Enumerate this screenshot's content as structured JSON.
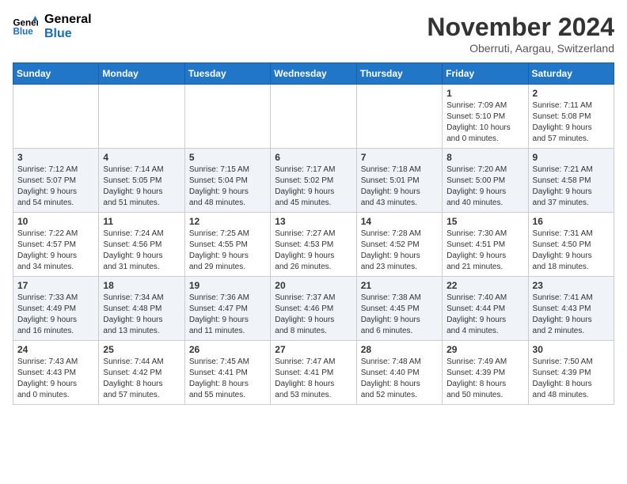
{
  "header": {
    "logo_line1": "General",
    "logo_line2": "Blue",
    "month_title": "November 2024",
    "location": "Oberruti, Aargau, Switzerland"
  },
  "weekdays": [
    "Sunday",
    "Monday",
    "Tuesday",
    "Wednesday",
    "Thursday",
    "Friday",
    "Saturday"
  ],
  "weeks": [
    [
      {
        "day": "",
        "info": ""
      },
      {
        "day": "",
        "info": ""
      },
      {
        "day": "",
        "info": ""
      },
      {
        "day": "",
        "info": ""
      },
      {
        "day": "",
        "info": ""
      },
      {
        "day": "1",
        "info": "Sunrise: 7:09 AM\nSunset: 5:10 PM\nDaylight: 10 hours\nand 0 minutes."
      },
      {
        "day": "2",
        "info": "Sunrise: 7:11 AM\nSunset: 5:08 PM\nDaylight: 9 hours\nand 57 minutes."
      }
    ],
    [
      {
        "day": "3",
        "info": "Sunrise: 7:12 AM\nSunset: 5:07 PM\nDaylight: 9 hours\nand 54 minutes."
      },
      {
        "day": "4",
        "info": "Sunrise: 7:14 AM\nSunset: 5:05 PM\nDaylight: 9 hours\nand 51 minutes."
      },
      {
        "day": "5",
        "info": "Sunrise: 7:15 AM\nSunset: 5:04 PM\nDaylight: 9 hours\nand 48 minutes."
      },
      {
        "day": "6",
        "info": "Sunrise: 7:17 AM\nSunset: 5:02 PM\nDaylight: 9 hours\nand 45 minutes."
      },
      {
        "day": "7",
        "info": "Sunrise: 7:18 AM\nSunset: 5:01 PM\nDaylight: 9 hours\nand 43 minutes."
      },
      {
        "day": "8",
        "info": "Sunrise: 7:20 AM\nSunset: 5:00 PM\nDaylight: 9 hours\nand 40 minutes."
      },
      {
        "day": "9",
        "info": "Sunrise: 7:21 AM\nSunset: 4:58 PM\nDaylight: 9 hours\nand 37 minutes."
      }
    ],
    [
      {
        "day": "10",
        "info": "Sunrise: 7:22 AM\nSunset: 4:57 PM\nDaylight: 9 hours\nand 34 minutes."
      },
      {
        "day": "11",
        "info": "Sunrise: 7:24 AM\nSunset: 4:56 PM\nDaylight: 9 hours\nand 31 minutes."
      },
      {
        "day": "12",
        "info": "Sunrise: 7:25 AM\nSunset: 4:55 PM\nDaylight: 9 hours\nand 29 minutes."
      },
      {
        "day": "13",
        "info": "Sunrise: 7:27 AM\nSunset: 4:53 PM\nDaylight: 9 hours\nand 26 minutes."
      },
      {
        "day": "14",
        "info": "Sunrise: 7:28 AM\nSunset: 4:52 PM\nDaylight: 9 hours\nand 23 minutes."
      },
      {
        "day": "15",
        "info": "Sunrise: 7:30 AM\nSunset: 4:51 PM\nDaylight: 9 hours\nand 21 minutes."
      },
      {
        "day": "16",
        "info": "Sunrise: 7:31 AM\nSunset: 4:50 PM\nDaylight: 9 hours\nand 18 minutes."
      }
    ],
    [
      {
        "day": "17",
        "info": "Sunrise: 7:33 AM\nSunset: 4:49 PM\nDaylight: 9 hours\nand 16 minutes."
      },
      {
        "day": "18",
        "info": "Sunrise: 7:34 AM\nSunset: 4:48 PM\nDaylight: 9 hours\nand 13 minutes."
      },
      {
        "day": "19",
        "info": "Sunrise: 7:36 AM\nSunset: 4:47 PM\nDaylight: 9 hours\nand 11 minutes."
      },
      {
        "day": "20",
        "info": "Sunrise: 7:37 AM\nSunset: 4:46 PM\nDaylight: 9 hours\nand 8 minutes."
      },
      {
        "day": "21",
        "info": "Sunrise: 7:38 AM\nSunset: 4:45 PM\nDaylight: 9 hours\nand 6 minutes."
      },
      {
        "day": "22",
        "info": "Sunrise: 7:40 AM\nSunset: 4:44 PM\nDaylight: 9 hours\nand 4 minutes."
      },
      {
        "day": "23",
        "info": "Sunrise: 7:41 AM\nSunset: 4:43 PM\nDaylight: 9 hours\nand 2 minutes."
      }
    ],
    [
      {
        "day": "24",
        "info": "Sunrise: 7:43 AM\nSunset: 4:43 PM\nDaylight: 9 hours\nand 0 minutes."
      },
      {
        "day": "25",
        "info": "Sunrise: 7:44 AM\nSunset: 4:42 PM\nDaylight: 8 hours\nand 57 minutes."
      },
      {
        "day": "26",
        "info": "Sunrise: 7:45 AM\nSunset: 4:41 PM\nDaylight: 8 hours\nand 55 minutes."
      },
      {
        "day": "27",
        "info": "Sunrise: 7:47 AM\nSunset: 4:41 PM\nDaylight: 8 hours\nand 53 minutes."
      },
      {
        "day": "28",
        "info": "Sunrise: 7:48 AM\nSunset: 4:40 PM\nDaylight: 8 hours\nand 52 minutes."
      },
      {
        "day": "29",
        "info": "Sunrise: 7:49 AM\nSunset: 4:39 PM\nDaylight: 8 hours\nand 50 minutes."
      },
      {
        "day": "30",
        "info": "Sunrise: 7:50 AM\nSunset: 4:39 PM\nDaylight: 8 hours\nand 48 minutes."
      }
    ]
  ]
}
